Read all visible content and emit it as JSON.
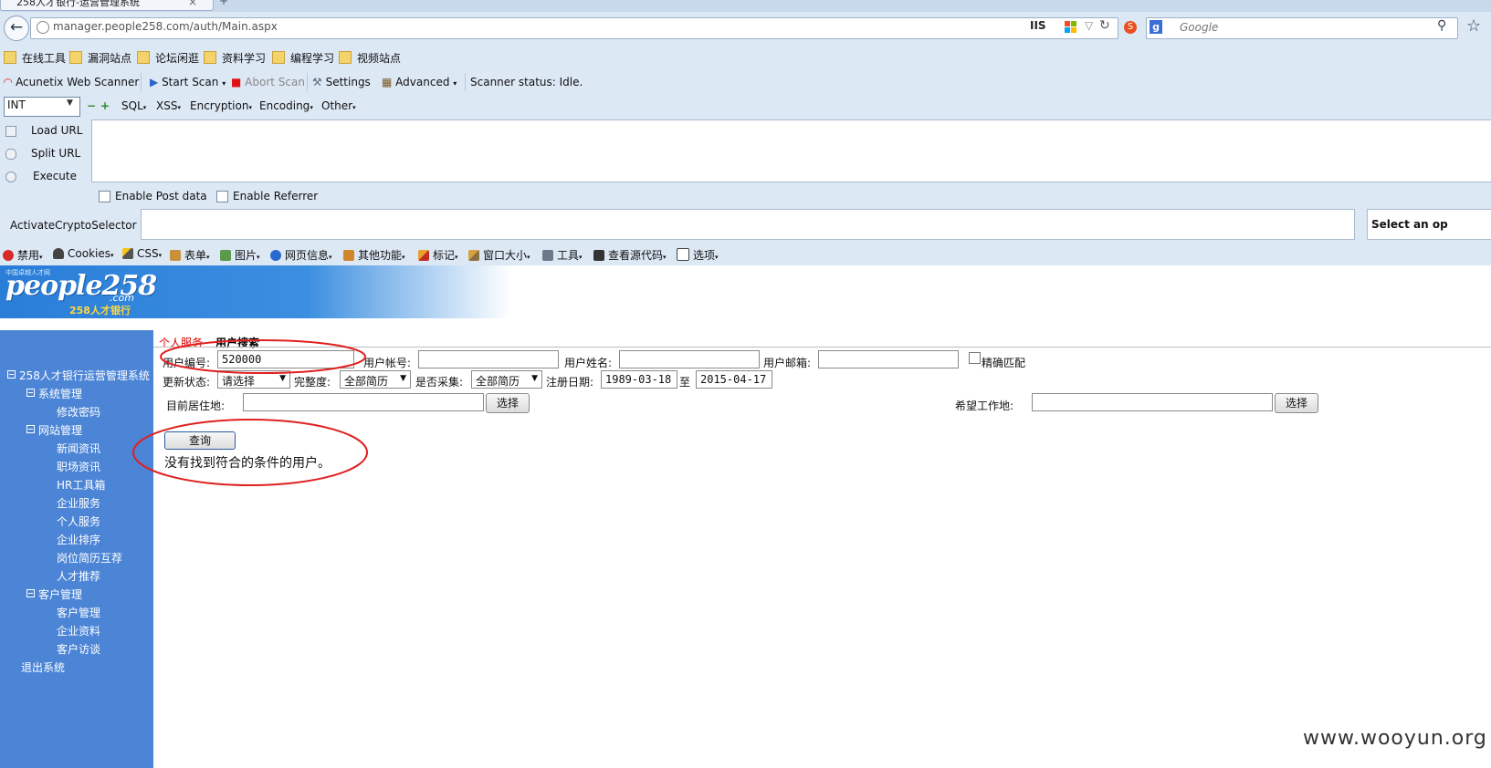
{
  "browser": {
    "tab_title": "258人才银行-运营管理系统",
    "url": "manager.people258.com/auth/Main.aspx",
    "url_badge": "IIS",
    "search_placeholder": "Google"
  },
  "bookmarks": [
    "在线工具",
    "漏洞站点",
    "论坛闲逛",
    "资料学习",
    "编程学习",
    "视频站点"
  ],
  "acunetix": {
    "brand": "Acunetix Web Scanner",
    "start_scan": "Start Scan",
    "abort_scan": "Abort Scan",
    "settings": "Settings",
    "advanced": "Advanced",
    "status": "Scanner status: Idle."
  },
  "hackbar": {
    "select_value": "INT",
    "menus": [
      "SQL",
      "XSS",
      "Encryption",
      "Encoding",
      "Other"
    ],
    "load_url": "Load URL",
    "split_url": "Split URL",
    "execute": "Execute",
    "enable_post": "Enable Post data",
    "enable_referrer": "Enable Referrer",
    "crypto_label": "ActivateCryptoSelector",
    "crypto_select": "Select an op"
  },
  "webdev": [
    "禁用",
    "Cookies",
    "CSS",
    "表单",
    "图片",
    "网页信息",
    "其他功能",
    "标记",
    "窗口大小",
    "工具",
    "查看源代码",
    "选项"
  ],
  "site": {
    "logo_text": "people258",
    "logo_com": ".com",
    "logo_cn": "258人才银行",
    "logo_small": "中国卓越人才网"
  },
  "sidebar": {
    "root": "258人才银行运营管理系统",
    "groups": [
      {
        "label": "系统管理",
        "items": [
          "修改密码"
        ]
      },
      {
        "label": "网站管理",
        "items": [
          "新闻资讯",
          "职场资讯",
          "HR工具箱",
          "企业服务",
          "个人服务",
          "企业排序",
          "岗位简历互荐",
          "人才推荐"
        ]
      },
      {
        "label": "客户管理",
        "items": [
          "客户管理",
          "企业资料",
          "客户访谈"
        ]
      }
    ],
    "logout": "退出系统"
  },
  "breadcrumb": {
    "section": "个人服务",
    "page": "用户搜索"
  },
  "form": {
    "user_id_label": "用户编号:",
    "user_id_value": "520000",
    "account_label": "用户帐号:",
    "name_label": "用户姓名:",
    "email_label": "用户邮箱:",
    "exact_match": "精确匹配",
    "status_label": "更新状态:",
    "status_value": "请选择",
    "completeness_label": "完整度:",
    "completeness_value": "全部简历",
    "collected_label": "是否采集:",
    "collected_value": "全部简历",
    "reg_date_label": "注册日期:",
    "date_from": "1989-03-18",
    "date_to_sep": "至",
    "date_to": "2015-04-17",
    "residence_label": "目前居住地:",
    "choose_button": "选择",
    "desired_label": "希望工作地:",
    "query_button": "查询",
    "result_message": "没有找到符合的条件的用户。"
  },
  "watermark": "www.wooyun.org",
  "colors": {
    "sidebar": "#4c85d6",
    "annotation": "#e02020",
    "chrome": "#dde8f5"
  }
}
